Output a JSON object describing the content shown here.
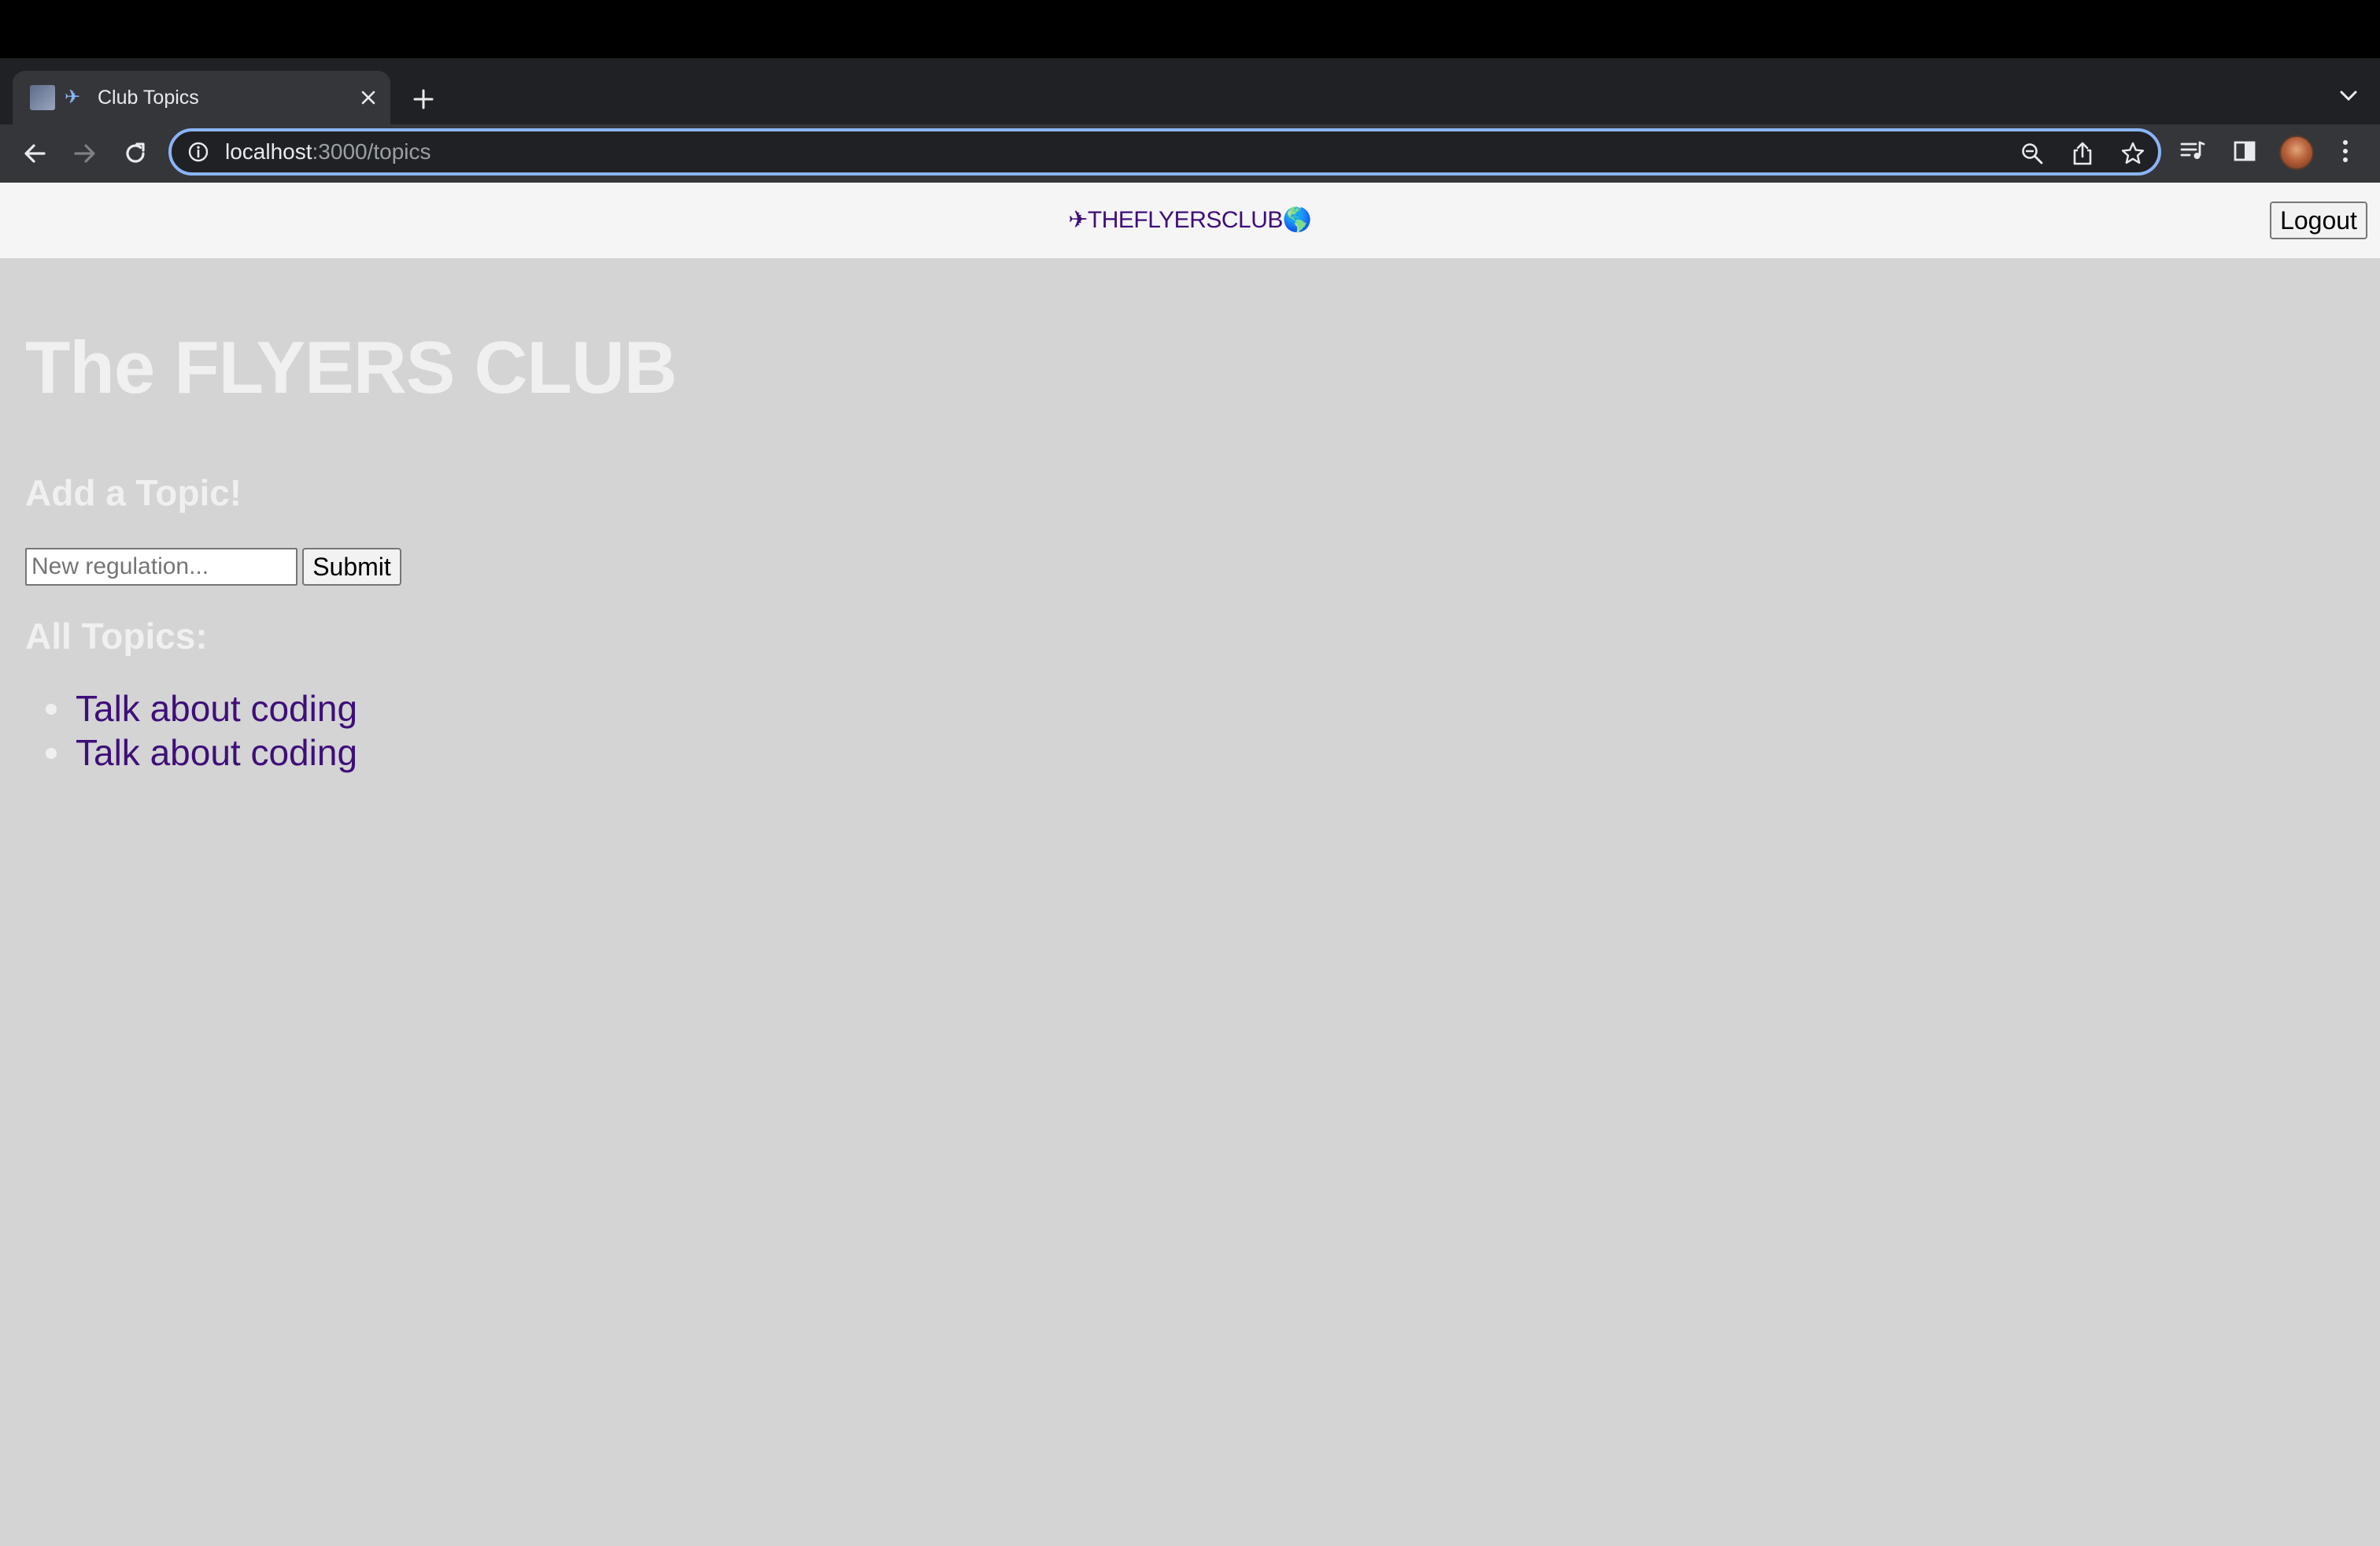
{
  "browser": {
    "tab": {
      "title": "Club Topics",
      "close_icon": "close-icon"
    },
    "address": {
      "host": "localhost",
      "rest": ":3000/topics"
    }
  },
  "site": {
    "brand": "✈THEFLYERSCLUB🌎",
    "logout_label": "Logout"
  },
  "main": {
    "title": "The FLYERS CLUB",
    "add_heading": "Add a Topic!",
    "input_placeholder": "New regulation...",
    "submit_label": "Submit",
    "all_heading": "All Topics:",
    "topics": [
      {
        "label": "Talk about coding"
      },
      {
        "label": "Talk about coding"
      }
    ]
  },
  "colors": {
    "page_bg": "#d4d4d4",
    "nav_bg": "#f5f5f5",
    "link": "#3e0f78",
    "heading": "#f0f0f0",
    "omnibox_focus": "#8ab4f8"
  }
}
